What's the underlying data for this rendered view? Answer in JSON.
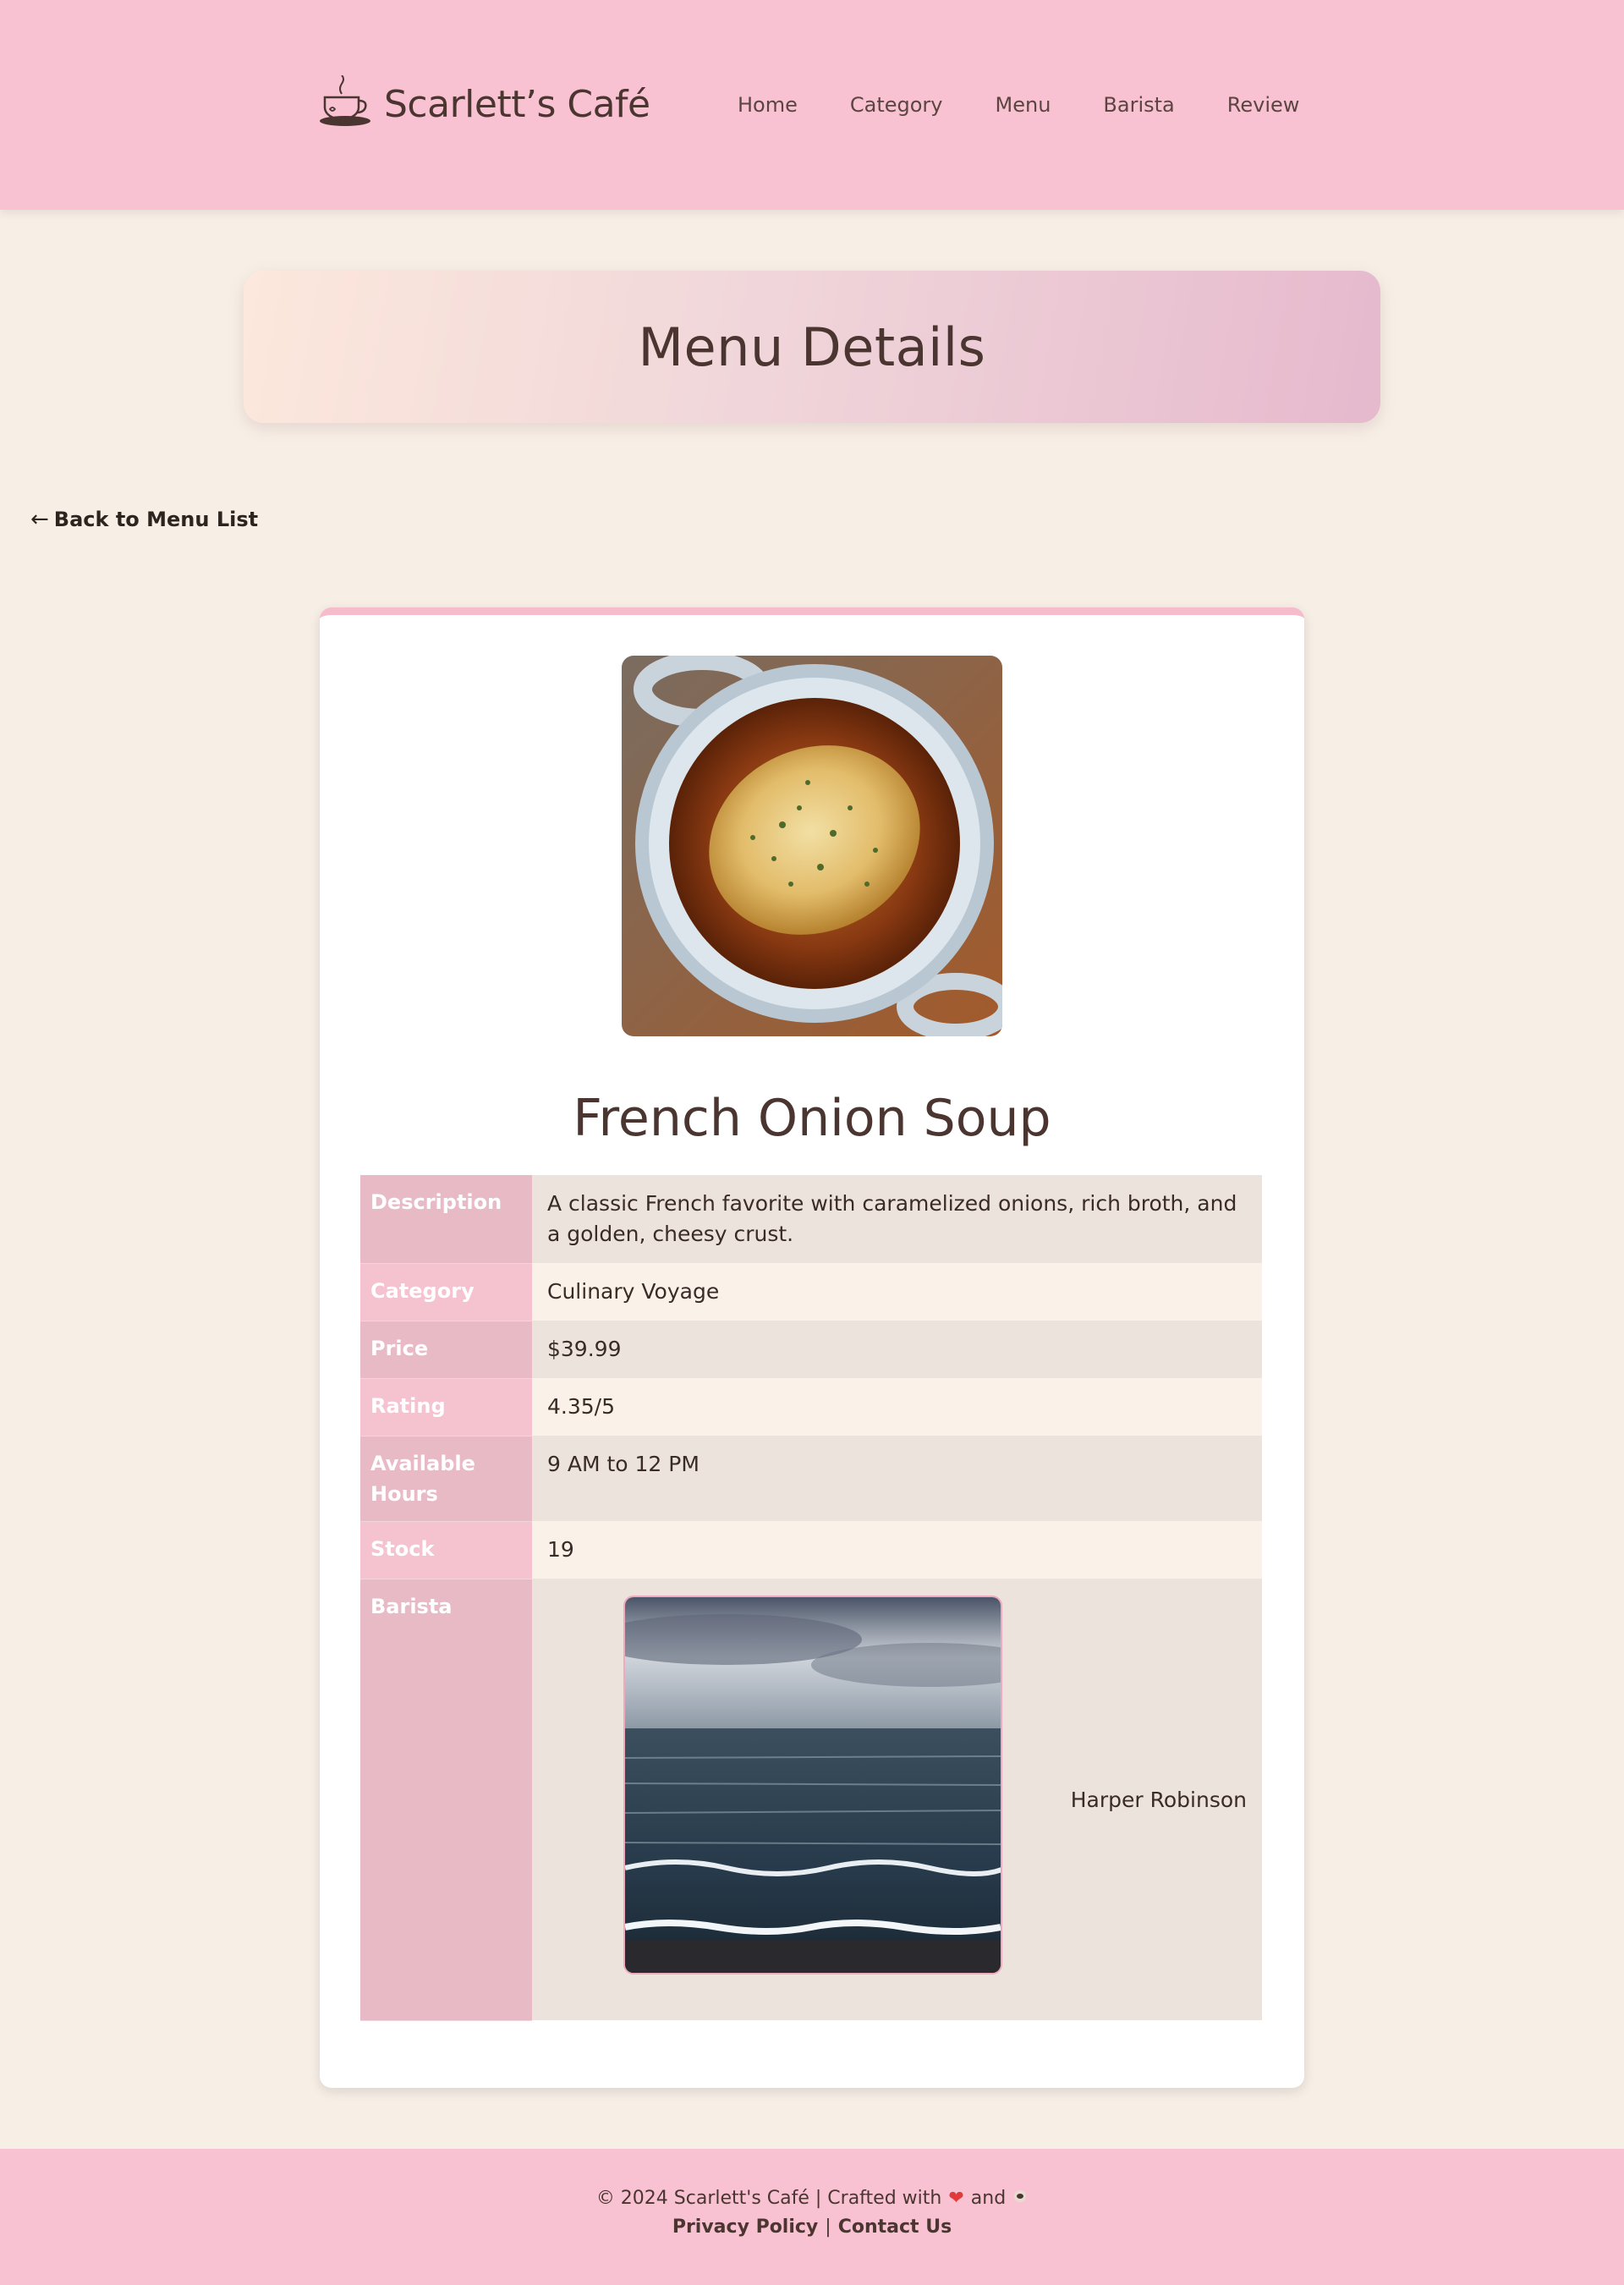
{
  "header": {
    "logo_text": "Scarlett’s Café",
    "logo_icon": "coffee-cup-icon",
    "nav": [
      {
        "label": "Home"
      },
      {
        "label": "Category"
      },
      {
        "label": "Menu"
      },
      {
        "label": "Barista"
      },
      {
        "label": "Review"
      }
    ]
  },
  "banner": {
    "title": "Menu Details"
  },
  "back_link": {
    "arrow": "←",
    "label": "Back to Menu List"
  },
  "item": {
    "name": "French Onion Soup",
    "photo": "french-onion-soup-photo",
    "rows": [
      {
        "label": "Description",
        "value": "A classic French favorite with caramelized onions, rich broth, and a golden, cheesy crust."
      },
      {
        "label": "Category",
        "value": "Culinary Voyage"
      },
      {
        "label": "Price",
        "value": "$39.99"
      },
      {
        "label": "Rating",
        "value": "4.35/5"
      },
      {
        "label": "Available Hours",
        "value": "9 AM to 12 PM"
      },
      {
        "label": "Stock",
        "value": "19"
      }
    ],
    "barista": {
      "label": "Barista",
      "name": "Harper Robinson",
      "photo": "ocean-seascape-photo"
    }
  },
  "footer": {
    "copyright": "© 2024 Scarlett's Café | Crafted with",
    "and": "and",
    "heart_icon": "heart-icon",
    "coffee_icon": "coffee-bean-icon",
    "privacy": "Privacy Policy",
    "separator": "|",
    "contact": "Contact Us"
  },
  "colors": {
    "header_bg": "#f9c2d2",
    "page_bg": "#f7efe6",
    "label_bg": "#e8bac5",
    "text": "#4a3530"
  }
}
